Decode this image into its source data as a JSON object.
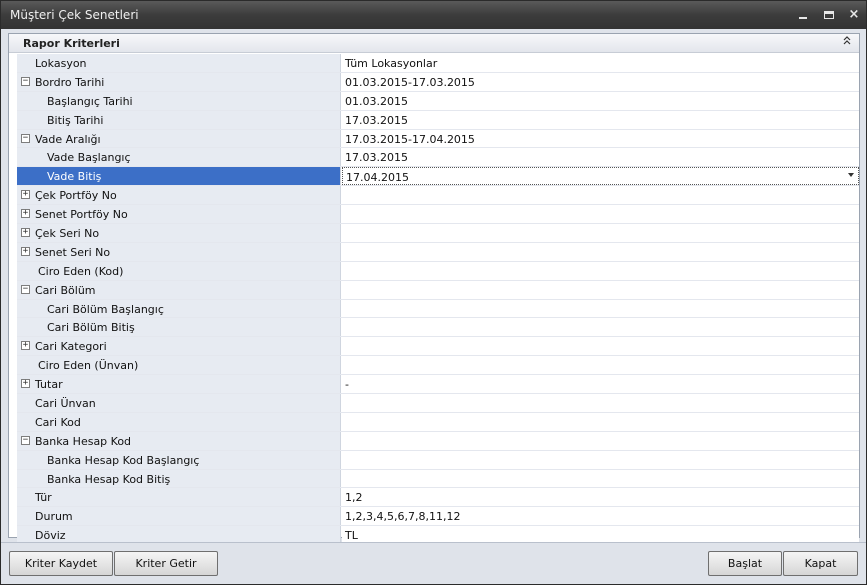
{
  "window": {
    "title": "Müşteri Çek Senetleri",
    "controls": {
      "minimize": "minimize-icon",
      "maximize": "maximize-icon",
      "close": "×"
    }
  },
  "panel": {
    "title": "Rapor Kriterleri",
    "collapse_glyph": "⌃⌃"
  },
  "grid": {
    "rows": [
      {
        "name": "Lokasyon",
        "value": "Tüm Lokasyonlar"
      },
      {
        "name": "Bordro Tarihi",
        "value": "01.03.2015-17.03.2015",
        "expander": "⊟"
      },
      {
        "name": "Başlangıç Tarihi",
        "value": "01.03.2015"
      },
      {
        "name": "Bitiş Tarihi",
        "value": "17.03.2015"
      },
      {
        "name": "Vade Aralığı",
        "value": "17.03.2015-17.04.2015",
        "expander": "⊟"
      },
      {
        "name": "Vade Başlangıç",
        "value": "17.03.2015"
      },
      {
        "name": "Vade Bitiş",
        "value": "17.04.2015",
        "selected": true
      },
      {
        "name": "Çek Portföy No",
        "value": "",
        "expander": "⊞"
      },
      {
        "name": "Senet Portföy No",
        "value": "",
        "expander": "⊞"
      },
      {
        "name": "Çek Seri No",
        "value": "",
        "expander": "⊞"
      },
      {
        "name": "Senet Seri No",
        "value": "",
        "expander": "⊞"
      },
      {
        "name": "Ciro Eden (Kod)",
        "value": ""
      },
      {
        "name": "Cari Bölüm",
        "value": "",
        "expander": "⊟"
      },
      {
        "name": "Cari Bölüm Başlangıç",
        "value": ""
      },
      {
        "name": "Cari Bölüm Bitiş",
        "value": ""
      },
      {
        "name": "Cari Kategori",
        "value": "",
        "expander": "⊞"
      },
      {
        "name": "Ciro Eden (Ünvan)",
        "value": ""
      },
      {
        "name": "Tutar",
        "value": "-",
        "expander": "⊞"
      },
      {
        "name": "Cari Ünvan",
        "value": ""
      },
      {
        "name": "Cari Kod",
        "value": ""
      },
      {
        "name": "Banka Hesap Kod",
        "value": "",
        "expander": "⊟"
      },
      {
        "name": "Banka Hesap Kod Başlangıç",
        "value": ""
      },
      {
        "name": "Banka Hesap Kod Bitiş",
        "value": ""
      },
      {
        "name": "Tür",
        "value": "1,2"
      },
      {
        "name": "Durum",
        "value": "1,2,3,4,5,6,7,8,11,12"
      },
      {
        "name": "Döviz",
        "value": "TL"
      }
    ]
  },
  "buttons": {
    "save": "Kriter Kaydet",
    "load": "Kriter Getir",
    "start": "Başlat",
    "close": "Kapat"
  },
  "colors": {
    "selected_row": "#3c6fc7",
    "category_column": "#e7ebf2",
    "title_bar": "#3c3c3c"
  }
}
